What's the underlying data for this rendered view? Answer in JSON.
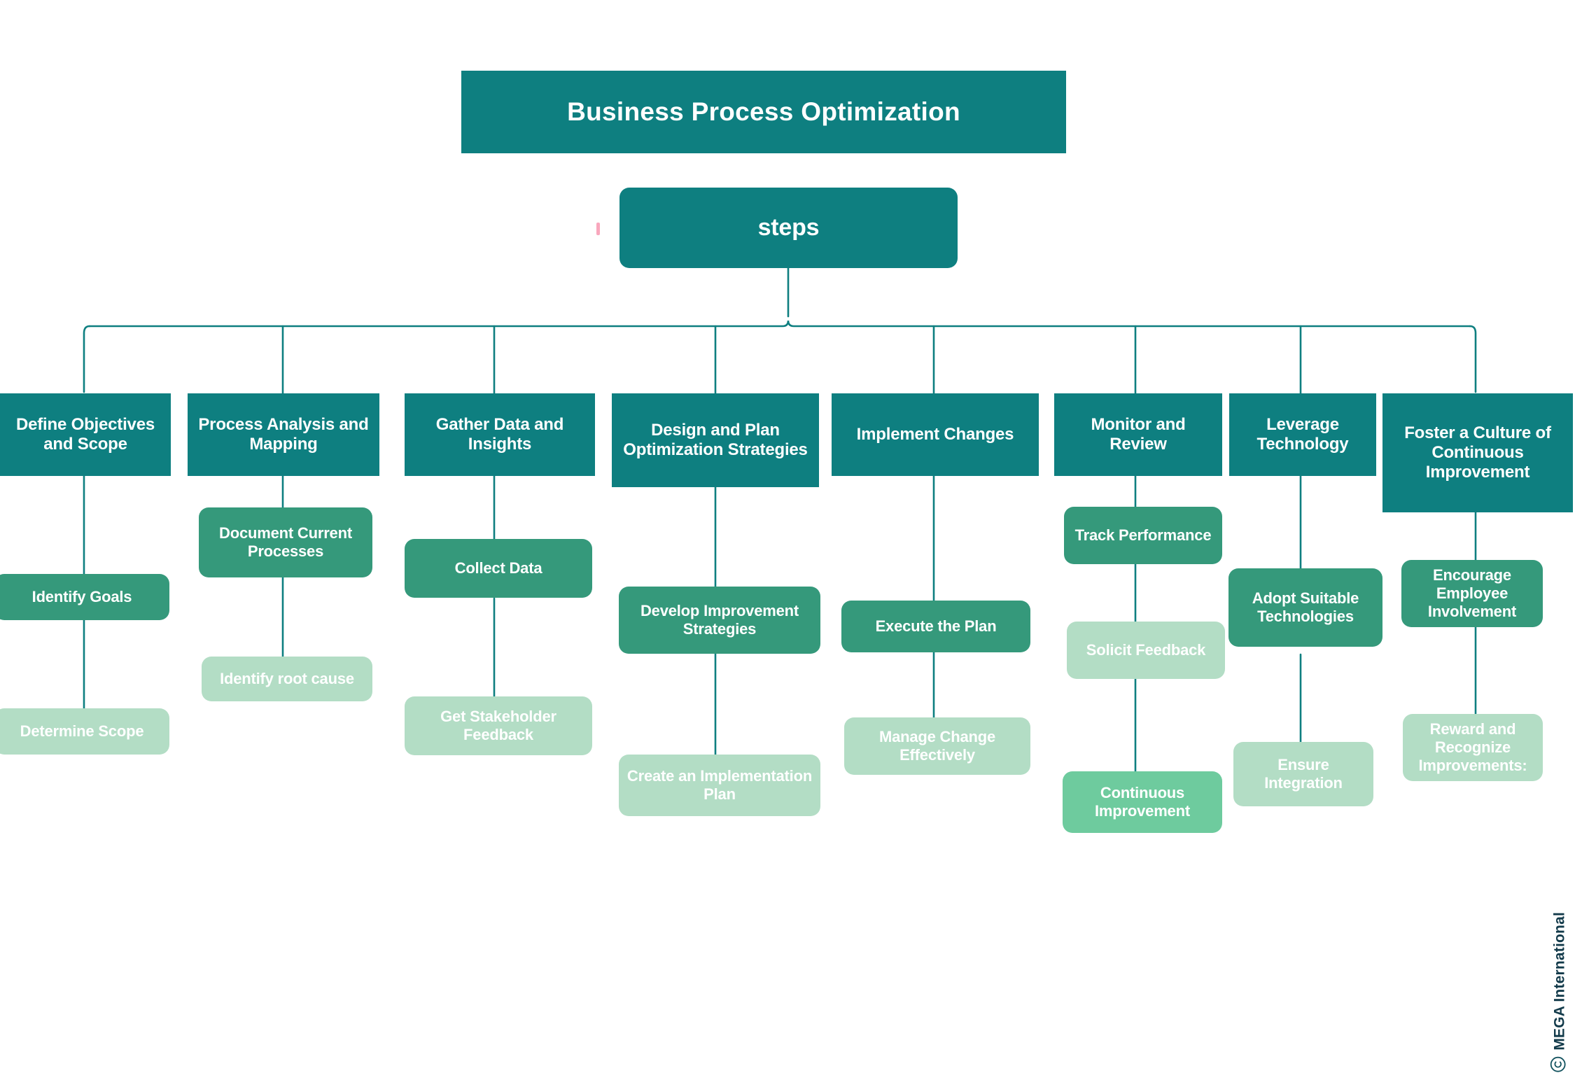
{
  "meta": {
    "colors": {
      "dark_teal": "#0e7f80",
      "mid_green": "#35997b",
      "mid_light_green": "#6ecb9e",
      "light_green": "#b3ddc5",
      "connector_line": "#0e7f80",
      "background": "#ffffff",
      "text_on_fill": "#ffffff",
      "watermark": "#123a4a",
      "pink_mark": "#f9a7bd"
    }
  },
  "title": {
    "text": "Business Process Optimization"
  },
  "root": {
    "text": "steps"
  },
  "watermark": {
    "text": "MEGA International",
    "symbol": "©"
  },
  "chart_data": {
    "type": "tree",
    "title": "Business Process Optimization",
    "root": "steps",
    "levels": [
      "title",
      "root",
      "phase",
      "task",
      "task"
    ],
    "branches": [
      {
        "phase": "Define Objectives and Scope",
        "tasks": [
          "Identify Goals",
          "Determine Scope"
        ]
      },
      {
        "phase": "Process Analysis and Mapping",
        "tasks": [
          "Document Current Processes",
          "Identify root cause"
        ]
      },
      {
        "phase": "Gather Data and Insights",
        "tasks": [
          "Collect Data",
          "Get Stakeholder Feedback"
        ]
      },
      {
        "phase": "Design and Plan Optimization Strategies",
        "tasks": [
          "Develop Improvement Strategies",
          "Create an Implementation Plan"
        ]
      },
      {
        "phase": "Implement Changes",
        "tasks": [
          "Execute the Plan",
          "Manage Change Effectively"
        ]
      },
      {
        "phase": "Monitor and Review",
        "tasks": [
          "Track Performance",
          "Solicit Feedback",
          "Continuous Improvement"
        ]
      },
      {
        "phase": "Leverage Technology",
        "tasks": [
          "Adopt Suitable Technologies",
          "Ensure Integration"
        ]
      },
      {
        "phase": "Foster a Culture of Continuous Improvement",
        "tasks": [
          "Encourage Employee Involvement",
          "Reward and Recognize Improvements:"
        ]
      }
    ]
  },
  "columns": [
    {
      "head": "Define Objectives and Scope",
      "t1": "Identify Goals",
      "t2": "Determine Scope"
    },
    {
      "head": "Process Analysis and Mapping",
      "t1": "Document Current Processes",
      "t2": "Identify root cause"
    },
    {
      "head": "Gather Data and Insights",
      "t1": "Collect Data",
      "t2": "Get Stakeholder Feedback"
    },
    {
      "head": "Design and Plan Optimization Strategies",
      "t1": "Develop Improvement Strategies",
      "t2": "Create an Implementation Plan"
    },
    {
      "head": "Implement Changes",
      "t1": "Execute the Plan",
      "t2": "Manage Change Effectively"
    },
    {
      "head": "Monitor and Review",
      "t1": "Track Performance",
      "t2": "Solicit Feedback",
      "t3": "Continuous Improvement"
    },
    {
      "head": "Leverage Technology",
      "t1": "Adopt Suitable Technologies",
      "t2": "Ensure Integration"
    },
    {
      "head": "Foster a Culture of Continuous Improvement",
      "t1": "Encourage Employee Involvement",
      "t2": "Reward and Recognize Improvements:"
    }
  ]
}
